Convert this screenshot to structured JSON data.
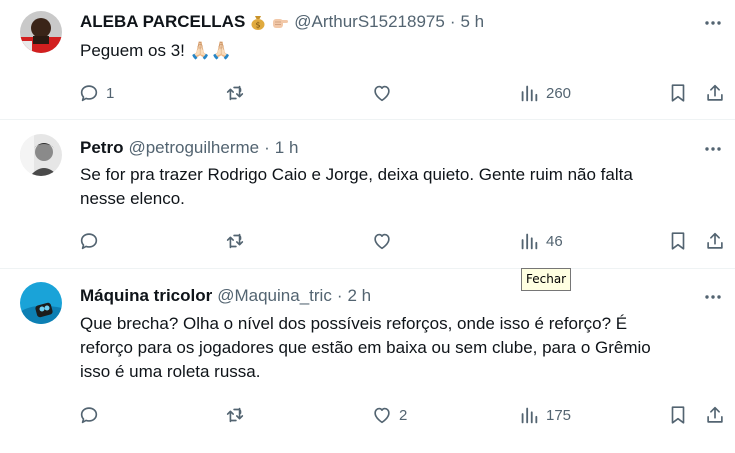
{
  "tweets": [
    {
      "display_name": "ALEBA PARCELLAS",
      "name_emojis": [
        "money-bag-emoji",
        "pointing-hand-emoji"
      ],
      "handle": "@ArthurS15218975",
      "separator": "·",
      "time": "5 h",
      "text_lines": [
        "Peguem os 3! 🙏🏻🙏🏻"
      ],
      "replies": "1",
      "retweets": "",
      "likes": "",
      "views": "260"
    },
    {
      "display_name": "Petro",
      "handle": "@petroguilherme",
      "separator": "·",
      "time": "1 h",
      "text_lines": [
        "Se for pra trazer Rodrigo Caio e Jorge, deixa quieto. Gente ruim não falta",
        "nesse elenco."
      ],
      "replies": "",
      "retweets": "",
      "likes": "",
      "views": "46"
    },
    {
      "display_name": "Máquina tricolor",
      "handle": "@Maquina_tric",
      "separator": "·",
      "time": "2 h",
      "text_lines": [
        "Que brecha? Olha o nível dos possíveis reforços, onde isso é reforço? É",
        "reforço para os jogadores que estão em baixa ou sem clube, para o Grêmio",
        "isso é uma roleta russa."
      ],
      "replies": "",
      "retweets": "",
      "likes": "2",
      "views": "175"
    }
  ],
  "tooltip": {
    "text": "Fechar"
  },
  "colors": {
    "text_primary": "#0f1419",
    "text_secondary": "#536471",
    "divider": "#eff3f4",
    "tooltip_bg": "#ffffe1"
  }
}
